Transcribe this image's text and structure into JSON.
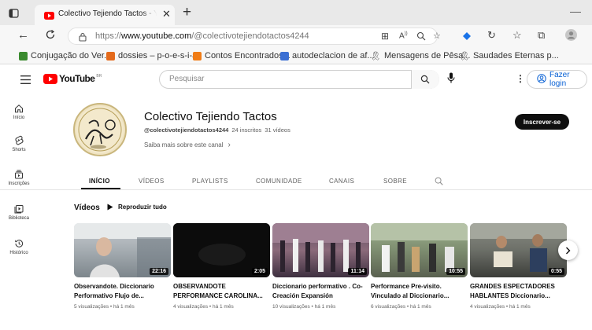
{
  "browser": {
    "tab_title": "Colectivo Tejiendo Tactos - YouTube",
    "url_prefix": "https://",
    "url_host": "www.youtube.com",
    "url_path": "/@colectivotejiendotactos4244",
    "bookmarks": [
      {
        "label": "Conjugação do Ver...",
        "icon": "bookmark-green",
        "color": "#3a8a2e"
      },
      {
        "label": "dossies – p-o-e-s-i-a",
        "icon": "blogger-orange",
        "color": "#e46a1c"
      },
      {
        "label": "Contos Encontrados...",
        "icon": "blogger-orange",
        "color": "#f07c16"
      },
      {
        "label": "autodeclacion de af...",
        "icon": "docs-blue",
        "color": "#3b6fd3"
      },
      {
        "label": "Mensagens de Pêsa...",
        "icon": "ribbon-gray",
        "color": "#555555"
      },
      {
        "label": "Saudades Eternas p...",
        "icon": "ribbon-gray",
        "color": "#555555"
      }
    ]
  },
  "youtube": {
    "logo_text": "YouTube",
    "region": "BR",
    "search_placeholder": "Pesquisar",
    "login_label": "Fazer login",
    "accent": "#ff0000"
  },
  "sidebar": [
    {
      "label": "Início",
      "icon": "home-icon"
    },
    {
      "label": "Shorts",
      "icon": "shorts-icon"
    },
    {
      "label": "Inscrições",
      "icon": "subscriptions-icon"
    },
    {
      "label": "Biblioteca",
      "icon": "library-icon"
    },
    {
      "label": "Histórico",
      "icon": "history-icon"
    }
  ],
  "channel": {
    "name": "Colectivo Tejiendo Tactos",
    "handle": "@colectivotejiendotactos4244",
    "subscribers": "24 inscritos",
    "videos": "31 vídeos",
    "about": "Saiba mais sobre este canal",
    "subscribe_label": "Inscrever-se"
  },
  "tabs": [
    "INÍCIO",
    "VÍDEOS",
    "PLAYLISTS",
    "COMUNIDADE",
    "CANAIS",
    "SOBRE"
  ],
  "section": {
    "title": "Vídeos",
    "play_all": "Reproduzir tudo"
  },
  "videos": [
    {
      "title": "Observandote. Diccionario Performativo Flujo de...",
      "duration": "22:16",
      "views": "5 visualizações",
      "age": "há 1 mês"
    },
    {
      "title": "OBSERVANDOTE PERFORMANCE CAROLINA...",
      "duration": "2:05",
      "views": "4 visualizações",
      "age": "há 1 mês"
    },
    {
      "title": "Diccionario performativo . Co-Creación Expansión",
      "duration": "11:14",
      "views": "10 visualizações",
      "age": "há 1 mês"
    },
    {
      "title": "Performance Pre-visito. Vinculado al Diccionario...",
      "duration": "10:55",
      "views": "6 visualizações",
      "age": "há 1 mês"
    },
    {
      "title": "GRANDES ESPECTADORES HABLANTES Diccionario...",
      "duration": "0:55",
      "views": "4 visualizações",
      "age": "há 1 mês"
    }
  ]
}
